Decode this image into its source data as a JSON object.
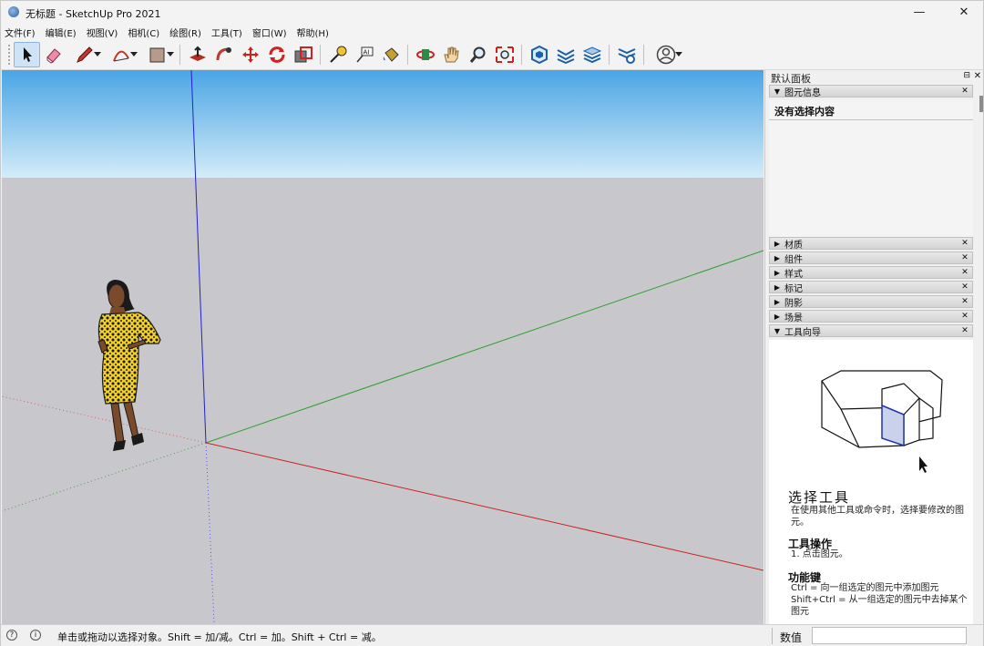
{
  "window": {
    "title": "无标题 - SketchUp Pro 2021",
    "controls": {
      "minimize": "—",
      "maximize": "☐",
      "close": "✕"
    }
  },
  "menubar": {
    "items": [
      "文件(F)",
      "编辑(E)",
      "视图(V)",
      "相机(C)",
      "绘图(R)",
      "工具(T)",
      "窗口(W)",
      "帮助(H)"
    ]
  },
  "toolbar": {
    "tools": [
      {
        "icon": "select-arrow-icon",
        "active": true
      },
      {
        "icon": "eraser-icon"
      },
      {
        "icon": "pencil-line-icon",
        "dropdown": true
      },
      {
        "icon": "arc-icon",
        "dropdown": true
      },
      {
        "icon": "rectangle-icon",
        "dropdown": true
      },
      {
        "icon": "push-pull-icon"
      },
      {
        "icon": "follow-me-icon"
      },
      {
        "icon": "move-icon"
      },
      {
        "icon": "rotate-icon"
      },
      {
        "icon": "scale-icon"
      },
      {
        "icon": "tape-measure-icon"
      },
      {
        "icon": "text-icon"
      },
      {
        "icon": "paint-bucket-icon"
      },
      {
        "icon": "orbit-icon"
      },
      {
        "icon": "pan-hand-icon"
      },
      {
        "icon": "zoom-icon"
      },
      {
        "icon": "zoom-extents-icon"
      },
      {
        "icon": "3d-warehouse-icon"
      },
      {
        "icon": "extension-warehouse-icon"
      },
      {
        "icon": "layout-icon"
      },
      {
        "icon": "extension-manager-icon"
      },
      {
        "icon": "account-icon",
        "dropdown": true
      }
    ]
  },
  "panel": {
    "title": "默认面板",
    "pin": "⊟",
    "close": "✕",
    "entity_info": {
      "label": "图元信息",
      "content": "没有选择内容"
    },
    "trays": [
      "材质",
      "组件",
      "样式",
      "标记",
      "阴影",
      "场景"
    ],
    "instructor": {
      "label": "工具向导",
      "title": "选择工具",
      "description": "在使用其他工具或命令时，选择要修改的图元。",
      "ops_heading": "工具操作",
      "ops": [
        "1. 点击图元。"
      ],
      "keys_heading": "功能键",
      "keys": [
        "Ctrl = 向一组选定的图元中添加图元",
        "Shift+Ctrl = 从一组选定的图元中去掉某个图元"
      ]
    }
  },
  "statusbar": {
    "hint": "单击或拖动以选择对象。Shift = 加/减。Ctrl = 加。Shift + Ctrl = 减。",
    "measurements_label": "数值",
    "measurements_value": ""
  },
  "colors": {
    "sky_top": "#49a6e6",
    "sky_bottom": "#d4ecf8",
    "ground": "#c8c8cc",
    "axis_red": "#cc2222",
    "axis_green": "#2aa02a",
    "axis_blue": "#2222cc"
  }
}
